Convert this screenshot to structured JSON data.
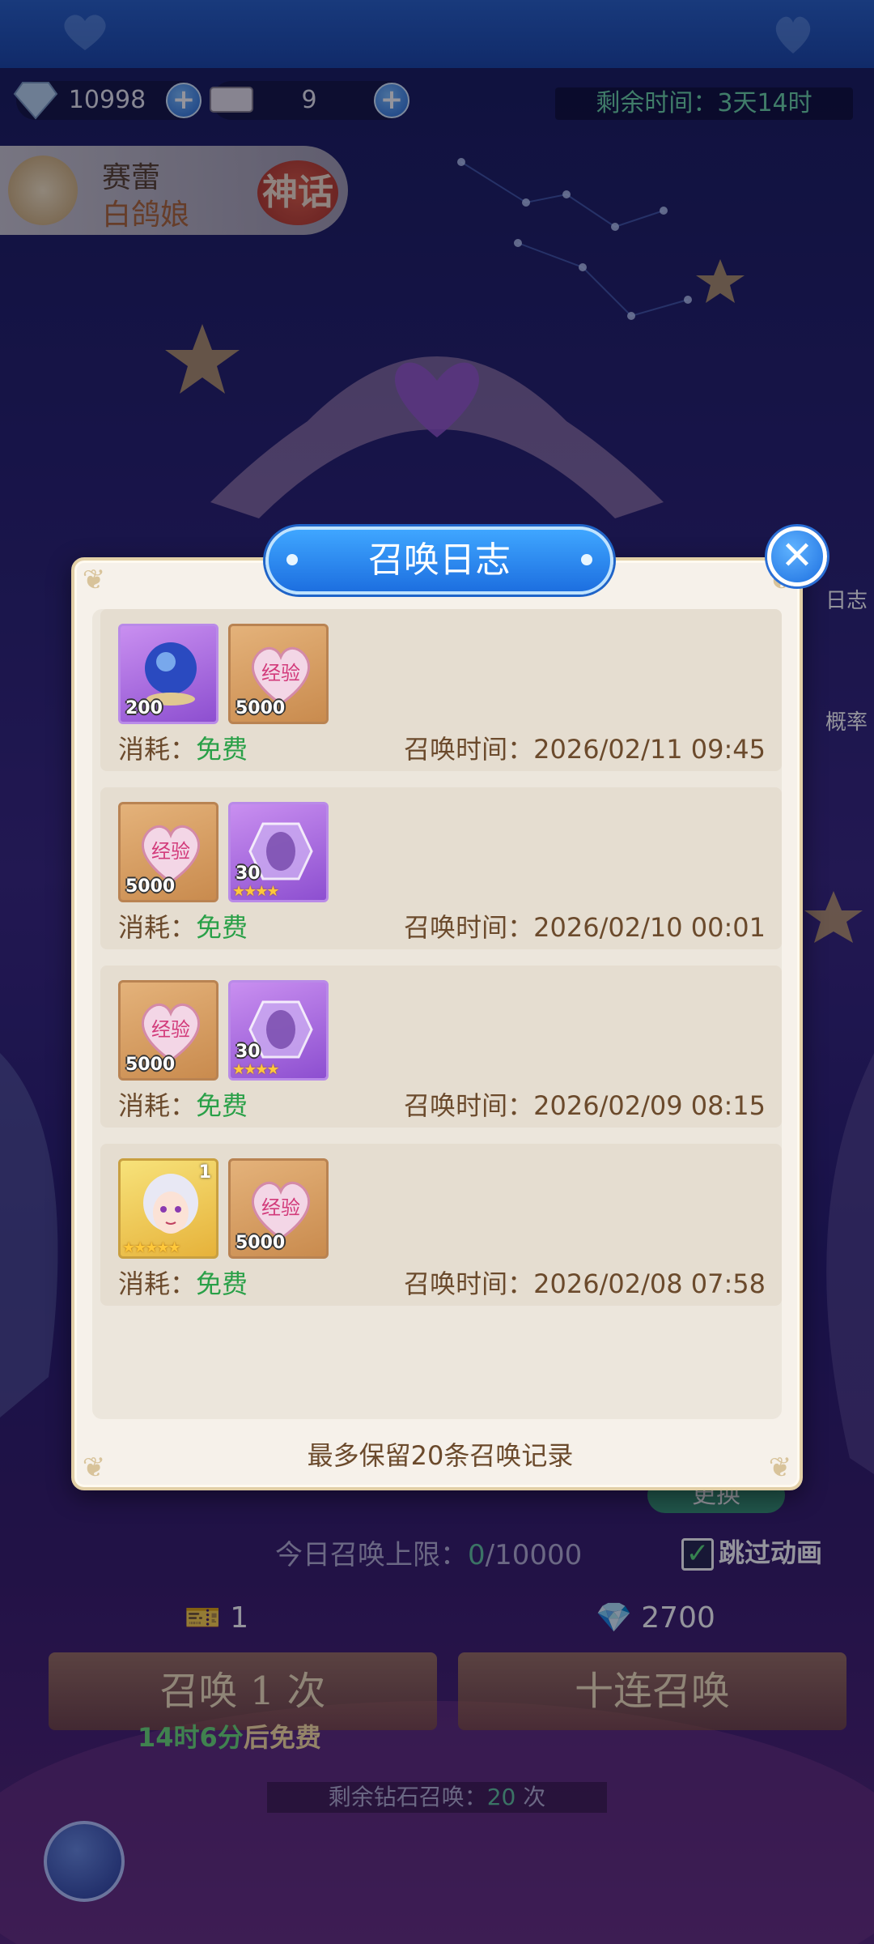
{
  "resources": {
    "diamonds": "10998",
    "tickets": "9",
    "time_left": "剩余时间：3天14时"
  },
  "hero": {
    "name": "赛蕾",
    "title": "白鸽娘",
    "rarity": "神话"
  },
  "side_buttons": {
    "log_label": "日志",
    "rate_label": "概率"
  },
  "underlay": {
    "change_label": "更换",
    "today_limit_prefix": "今日召唤上限：",
    "today_limit_used": "0",
    "today_limit_total": "/10000",
    "skip_animation": "跳过动画",
    "cost_one": "1",
    "cost_ten": "2700",
    "summon_one": "召唤 1 次",
    "summon_ten": "十连召唤",
    "free_timer_green": "14时6分",
    "free_timer_suffix": "后免费",
    "diamond_left_prefix": "剩余钻石召唤：",
    "diamond_left_count": "20",
    "diamond_left_suffix": " 次"
  },
  "modal": {
    "title": "召唤日志",
    "close_icon": "close-icon",
    "footer": "最多保留20条召唤记录",
    "records": [
      {
        "cost_label": "消耗：",
        "cost_value": "免费",
        "time_label": "召唤时间：",
        "time_value": "2026/02/11 09:45",
        "items": [
          {
            "type": "crystal-orb",
            "qty": "200"
          },
          {
            "type": "exp-heart",
            "qty": "5000"
          }
        ]
      },
      {
        "cost_label": "消耗：",
        "cost_value": "免费",
        "time_label": "召唤时间：",
        "time_value": "2026/02/10 00:01",
        "items": [
          {
            "type": "exp-heart",
            "qty": "5000"
          },
          {
            "type": "shard-crystal",
            "qty": "30",
            "stars": "★★★★"
          }
        ]
      },
      {
        "cost_label": "消耗：",
        "cost_value": "免费",
        "time_label": "召唤时间：",
        "time_value": "2026/02/09 08:15",
        "items": [
          {
            "type": "exp-heart",
            "qty": "5000"
          },
          {
            "type": "shard-crystal",
            "qty": "30",
            "stars": "★★★★"
          }
        ]
      },
      {
        "cost_label": "消耗：",
        "cost_value": "免费",
        "time_label": "召唤时间：",
        "time_value": "2026/02/08 07:58",
        "items": [
          {
            "type": "character-portrait",
            "level": "1",
            "stars": "★★★★★"
          },
          {
            "type": "exp-heart",
            "qty": "5000"
          }
        ]
      }
    ]
  },
  "colors": {
    "free_green": "#2aa048",
    "title_blue": "#1d6fe0",
    "text_brown": "#6b4a2c"
  }
}
